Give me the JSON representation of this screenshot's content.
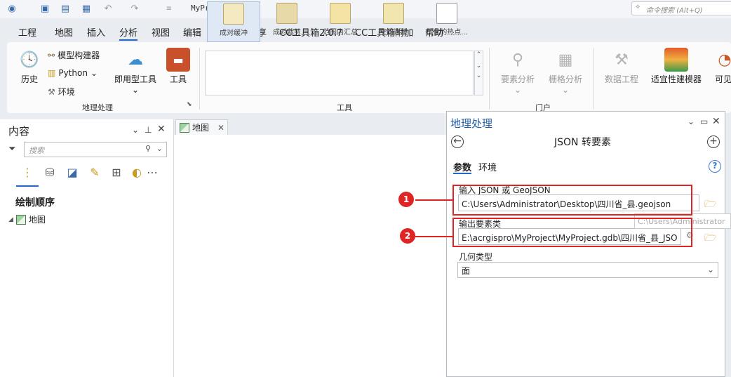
{
  "titlebar": {
    "project": "MyProject",
    "command_search_placeholder": "命令搜索 (Alt+Q)"
  },
  "menu": [
    "工程",
    "地图",
    "插入",
    "分析",
    "视图",
    "编辑",
    "影像",
    "共享",
    "CC工具箱2.0.7",
    "CC工具箱附加",
    "帮助"
  ],
  "ribbon": {
    "geoprocessing": {
      "history": "历史",
      "model_builder": "模型构建器",
      "python": "Python",
      "environments": "环境",
      "ready_tools": "即用型工具",
      "tools": "工具",
      "group_label": "地理处理"
    },
    "gallery": {
      "items": [
        "成对缓冲",
        "成对裁剪",
        "范围内汇总",
        "空间连接",
        "优化的热点..."
      ],
      "group_label": "工具"
    },
    "portal": {
      "feature_analysis": "要素分析",
      "raster_analysis": "栅格分析",
      "group_label": "门户"
    },
    "data_engineering": "数据工程",
    "suitability_modeler": "适宜性建模器",
    "visible": "可见"
  },
  "contents": {
    "title": "内容",
    "search_placeholder": "搜索",
    "draw_order": "绘制顺序",
    "map_item": "地图"
  },
  "map_tab": {
    "label": "地图"
  },
  "gp": {
    "title": "地理处理",
    "tool_name": "JSON 转要素",
    "tab_params": "参数",
    "tab_env": "环境",
    "input_label": "输入 JSON 或 GeoJSON",
    "input_value": "C:\\Users\\Administrator\\Desktop\\四川省_县.geojson",
    "output_label": "输出要素类",
    "output_value": "E:\\acrgispro\\MyProject\\MyProject.gdb\\四川省_县_JSO",
    "tooltip": "C:\\Users\\Administrator",
    "geom_label": "几何类型",
    "geom_value": "面",
    "markers": [
      "1",
      "2"
    ]
  }
}
